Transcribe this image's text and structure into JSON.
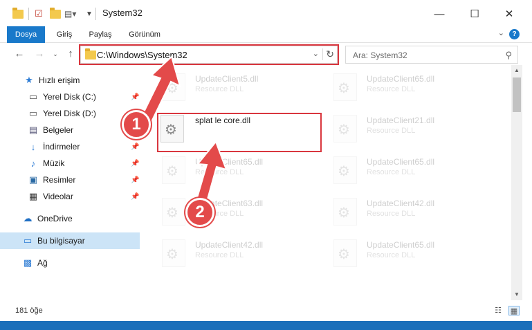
{
  "window": {
    "title": "System32",
    "controls": {
      "minimize": "—",
      "maximize": "☐",
      "close": "✕"
    }
  },
  "ribbon": {
    "tabs": [
      {
        "label": "Dosya",
        "active": true
      },
      {
        "label": "Giriş",
        "active": false
      },
      {
        "label": "Paylaş",
        "active": false
      },
      {
        "label": "Görünüm",
        "active": false
      }
    ],
    "help": "?"
  },
  "nav": {
    "address": "C:\\Windows\\System32",
    "search_placeholder": "Ara: System32"
  },
  "sidebar": {
    "items": [
      {
        "label": "Hızlı erişim",
        "icon": "star-icon",
        "pinned": false
      },
      {
        "label": "Yerel Disk (C:)",
        "icon": "drive-c-icon",
        "pinned": true
      },
      {
        "label": "Yerel Disk (D:)",
        "icon": "drive-d-icon",
        "pinned": true
      },
      {
        "label": "Belgeler",
        "icon": "documents-icon",
        "pinned": true
      },
      {
        "label": "İndirmeler",
        "icon": "downloads-icon",
        "pinned": true
      },
      {
        "label": "Müzik",
        "icon": "music-icon",
        "pinned": true
      },
      {
        "label": "Resimler",
        "icon": "pictures-icon",
        "pinned": true
      },
      {
        "label": "Videolar",
        "icon": "videos-icon",
        "pinned": true
      },
      {
        "label": "OneDrive",
        "icon": "onedrive-icon",
        "pinned": false
      },
      {
        "label": "Bu bilgisayar",
        "icon": "this-pc-icon",
        "pinned": false,
        "selected": true
      },
      {
        "label": "Ağ",
        "icon": "network-icon",
        "pinned": false
      }
    ]
  },
  "files": [
    {
      "name": "UpdateClient5.dll",
      "type": "Resource DLL",
      "faded": true
    },
    {
      "name": "UpdateClient65.dll",
      "type": "Resource DLL",
      "faded": true
    },
    {
      "name": "splat le core.dll",
      "type": "",
      "faded": false
    },
    {
      "name": "UpdateClient21.dll",
      "type": "Resource DLL",
      "faded": true
    },
    {
      "name": "UpdateClient65.dll",
      "type": "Resource DLL",
      "faded": true
    },
    {
      "name": "UpdateClient65.dll",
      "type": "Resource DLL",
      "faded": true
    },
    {
      "name": "UpdateClient63.dll",
      "type": "Resource DLL",
      "faded": true
    },
    {
      "name": "UpdateClient42.dll",
      "type": "Resource DLL",
      "faded": true
    },
    {
      "name": "UpdateClient42.dll",
      "type": "Resource DLL",
      "faded": true
    },
    {
      "name": "UpdateClient65.dll",
      "type": "Resource DLL",
      "faded": true
    }
  ],
  "status": {
    "item_count": "181 öğe"
  },
  "annotations": {
    "step1": "1",
    "step2": "2"
  },
  "colors": {
    "accent": "#1979ca",
    "highlight": "#d9363e",
    "badge": "#e34a4a"
  }
}
